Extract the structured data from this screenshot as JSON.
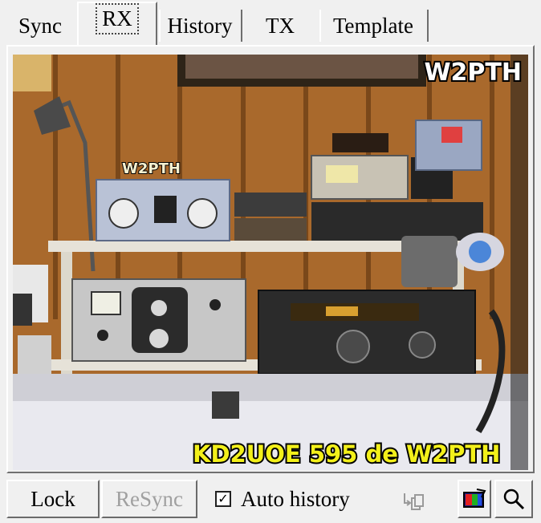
{
  "tabs": [
    {
      "label": "Sync"
    },
    {
      "label": "RX"
    },
    {
      "label": "History"
    },
    {
      "label": "TX"
    },
    {
      "label": "Template"
    }
  ],
  "active_tab": "RX",
  "image": {
    "callsign_top": "W2PTH",
    "panel_label": "W2PTH",
    "caption": "KD2UOE 595 de W2PTH",
    "frequency_readout": "."
  },
  "controls": {
    "lock_label": "Lock",
    "resync_label": "ReSync",
    "auto_history_label": "Auto history",
    "auto_history_checked": true,
    "check_mark": "✓"
  },
  "icons": [
    "copy-icon",
    "color-image-icon",
    "magnifier-icon"
  ],
  "colors": {
    "caption_fill": "#f3f01a",
    "window_bg": "#f0f0f0"
  }
}
